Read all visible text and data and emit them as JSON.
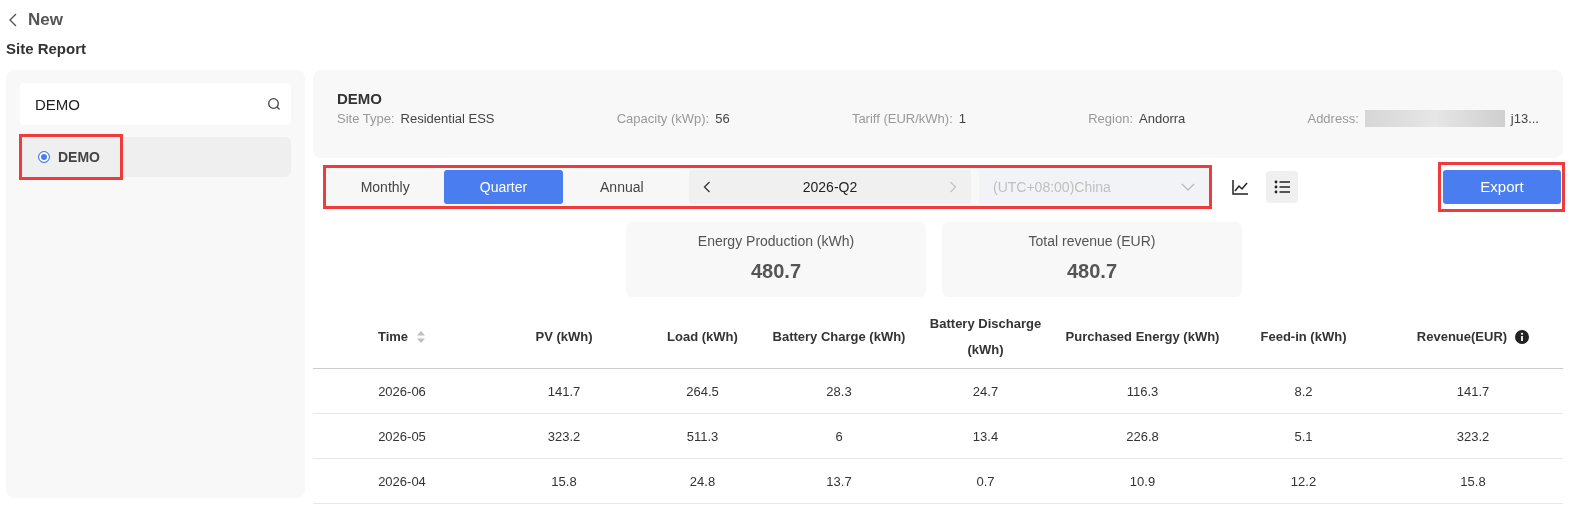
{
  "header": {
    "back_label": "New",
    "page_title": "Site Report"
  },
  "sidebar": {
    "search": {
      "value": "DEMO"
    },
    "sites": [
      {
        "name": "DEMO",
        "selected": true,
        "highlighted": true
      }
    ]
  },
  "site": {
    "name": "DEMO",
    "fields": [
      {
        "label": "Site Type:",
        "value": "Residential ESS"
      },
      {
        "label": "Capacity (kWp):",
        "value": "56"
      },
      {
        "label": "Tariff (EUR/kWh):",
        "value": "1"
      },
      {
        "label": "Region:",
        "value": "Andorra"
      },
      {
        "label": "Address:",
        "value": "j13...",
        "redacted": true
      }
    ]
  },
  "controls": {
    "highlighted": true,
    "periods": [
      {
        "label": "Monthly",
        "selected": false
      },
      {
        "label": "Quarter",
        "selected": true
      },
      {
        "label": "Annual",
        "selected": false
      }
    ],
    "period_value": "2026-Q2",
    "next_disabled": true,
    "timezone": {
      "value": "(UTC+08:00)China",
      "disabled": true
    },
    "views": [
      {
        "kind": "chart",
        "selected": false
      },
      {
        "kind": "list",
        "selected": true
      }
    ]
  },
  "export": {
    "label": "Export",
    "highlighted": true
  },
  "summary": [
    {
      "label": "Energy Production (kWh)",
      "value": "480.7"
    },
    {
      "label": "Total revenue (EUR)",
      "value": "480.7"
    }
  ],
  "table": {
    "columns": [
      {
        "label": "Time",
        "sortable": true
      },
      {
        "label": "PV (kWh)"
      },
      {
        "label": "Load (kWh)"
      },
      {
        "label": "Battery Charge (kWh)"
      },
      {
        "label": "Battery Discharge (kWh)"
      },
      {
        "label": "Purchased Energy (kWh)"
      },
      {
        "label": "Feed-in (kWh)"
      },
      {
        "label": "Revenue(EUR)",
        "info": true
      }
    ],
    "rows": [
      [
        "2026-06",
        "141.7",
        "264.5",
        "28.3",
        "24.7",
        "116.3",
        "8.2",
        "141.7"
      ],
      [
        "2026-05",
        "323.2",
        "511.3",
        "6",
        "13.4",
        "226.8",
        "5.1",
        "323.2"
      ],
      [
        "2026-04",
        "15.8",
        "24.8",
        "13.7",
        "0.7",
        "10.9",
        "12.2",
        "15.8"
      ]
    ]
  }
}
